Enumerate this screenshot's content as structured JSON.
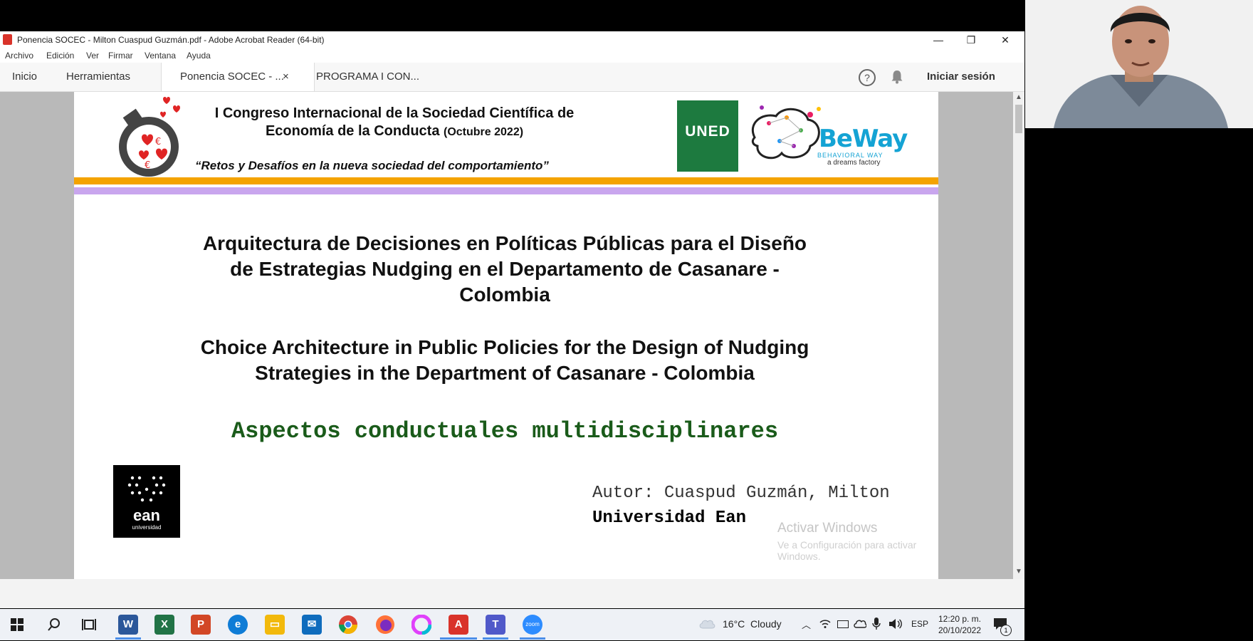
{
  "window": {
    "title": "Ponencia SOCEC - Milton Cuaspud Guzmán.pdf - Adobe Acrobat Reader (64-bit)",
    "controls": {
      "minimize": "—",
      "restore": "❐",
      "close": "✕"
    }
  },
  "menu": [
    "Archivo",
    "Edición",
    "Ver",
    "Firmar",
    "Ventana",
    "Ayuda"
  ],
  "tabs": {
    "home": "Inicio",
    "tools": "Herramientas",
    "docs": [
      "Ponencia SOCEC - ...",
      "PROGRAMA I CON..."
    ],
    "close_symbol": "×",
    "help_symbol": "?",
    "signin": "Iniciar sesión"
  },
  "slide": {
    "header_line1": "I Congreso Internacional de la Sociedad Científica de",
    "header_line2_main": "Economía de la Conducta",
    "header_line2_paren": "(Octubre 2022)",
    "slogan": "“Retos y Desafíos en la nueva sociedad del comportamiento”",
    "logo_uned": "UNED",
    "logo_beway": "BeWay",
    "logo_beway_tag1": "BEHAVIORAL WAY",
    "logo_beway_tag2": "a dreams factory",
    "title_es": [
      "Arquitectura de Decisiones en Políticas Públicas para el Diseño",
      "de Estrategias Nudging en el Departamento de Casanare -",
      "Colombia"
    ],
    "title_en": [
      "Choice Architecture in Public Policies for the Design of Nudging",
      "Strategies in the Department of Casanare - Colombia"
    ],
    "subtitle": "Aspectos conductuales multidisciplinares",
    "ean_logo": "ean",
    "ean_sub": "universidad",
    "author": "Autor: Cuaspud Guzmán, Milton",
    "university": "Universidad Ean",
    "watermark_title": "Activar Windows",
    "watermark_sub": "Ve a Configuración para activar Windows."
  },
  "taskbar": {
    "weather": "16°C  Cloudy",
    "lang": "ESP",
    "time": "12:20 p. m.",
    "date": "20/10/2022",
    "notif_count": "1",
    "zoom_label": "zoom",
    "colors": {
      "word": "#2b579a",
      "excel": "#217346",
      "powerpoint": "#d24726",
      "edge": "#0f7cd6",
      "explorer": "#f2b90c",
      "mail": "#0f6cbd",
      "acrobat": "#d9332a",
      "teams": "#5059c9",
      "zoom": "#2d8cff"
    }
  }
}
